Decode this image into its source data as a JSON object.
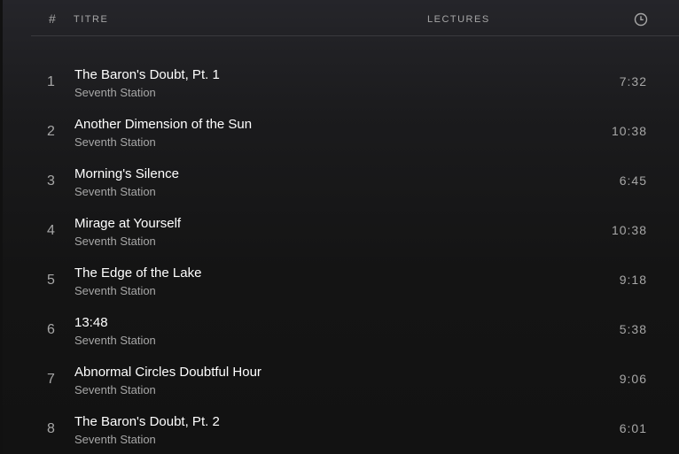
{
  "header": {
    "number": "#",
    "title": "TITRE",
    "plays": "LECTURES",
    "duration_icon": "clock-icon"
  },
  "tracks": [
    {
      "number": "1",
      "title": "The Baron's Doubt, Pt. 1",
      "artist": "Seventh Station",
      "duration": "7:32"
    },
    {
      "number": "2",
      "title": "Another Dimension of the Sun",
      "artist": "Seventh Station",
      "duration": "10:38"
    },
    {
      "number": "3",
      "title": "Morning's Silence",
      "artist": "Seventh Station",
      "duration": "6:45"
    },
    {
      "number": "4",
      "title": "Mirage at Yourself",
      "artist": "Seventh Station",
      "duration": "10:38"
    },
    {
      "number": "5",
      "title": "The Edge of the Lake",
      "artist": "Seventh Station",
      "duration": "9:18"
    },
    {
      "number": "6",
      "title": "13:48",
      "artist": "Seventh Station",
      "duration": "5:38"
    },
    {
      "number": "7",
      "title": "Abnormal Circles Doubtful Hour",
      "artist": "Seventh Station",
      "duration": "9:06"
    },
    {
      "number": "8",
      "title": "The Baron's Doubt, Pt. 2",
      "artist": "Seventh Station",
      "duration": "6:01"
    }
  ]
}
